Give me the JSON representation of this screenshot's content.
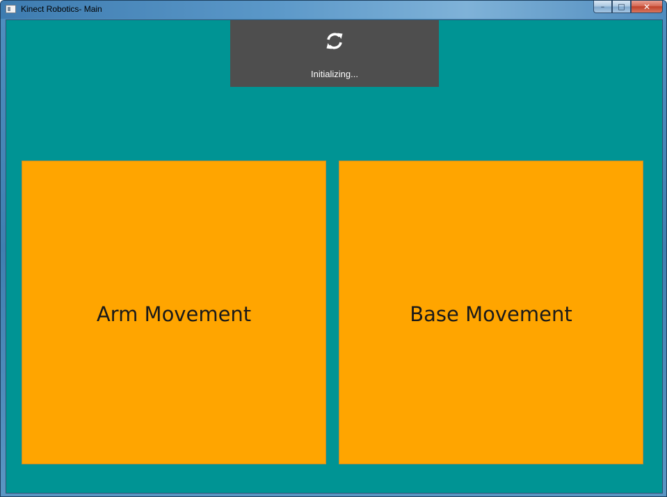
{
  "window": {
    "title": "Kinect Robotics- Main",
    "minimize_glyph": "–",
    "maximize_glyph": "□",
    "close_glyph": "✕"
  },
  "status": {
    "icon": "refresh-icon",
    "text": "Initializing..."
  },
  "tiles": [
    {
      "label": "Arm Movement"
    },
    {
      "label": "Base Movement"
    }
  ],
  "colors": {
    "background": "#009494",
    "status_panel": "#4e4e4e",
    "tile": "#ffa500"
  }
}
